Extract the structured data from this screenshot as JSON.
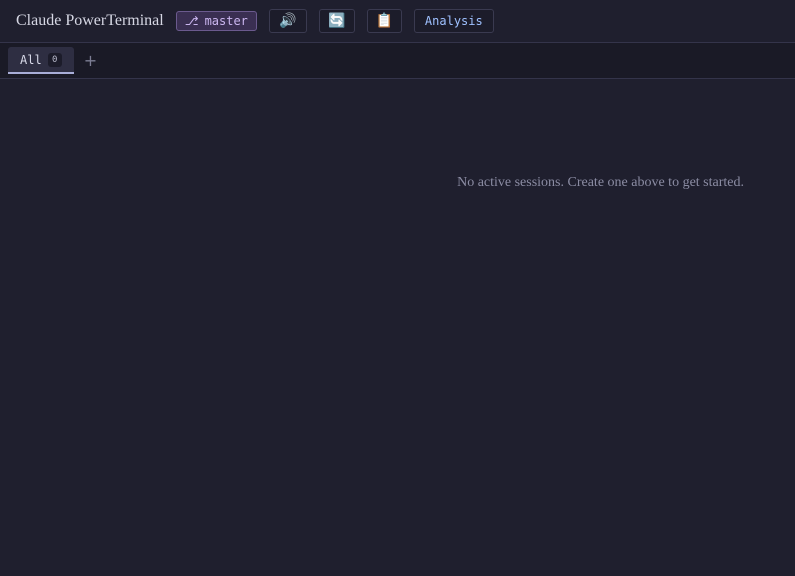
{
  "header": {
    "title": "Claude PowerTerminal",
    "branch": {
      "icon": "⎇",
      "icon_name": "git-branch-icon",
      "name": "master"
    },
    "sound_button": {
      "icon": "🔊",
      "icon_name": "speaker-icon"
    },
    "refresh_button": {
      "icon": "🔄",
      "icon_name": "refresh-icon"
    },
    "clipboard_button": {
      "icon": "📋",
      "icon_name": "clipboard-icon"
    },
    "analysis_label": "Analysis"
  },
  "tabs": {
    "items": [
      {
        "label": "All",
        "count": "0",
        "active": true
      }
    ],
    "add_label": "+"
  },
  "main": {
    "empty_message": "No active sessions. Create one above to get started."
  },
  "colors": {
    "background": "#1f1f2e",
    "branch_accent": "#cbb6f0",
    "analysis_accent": "#9fc1ff"
  }
}
